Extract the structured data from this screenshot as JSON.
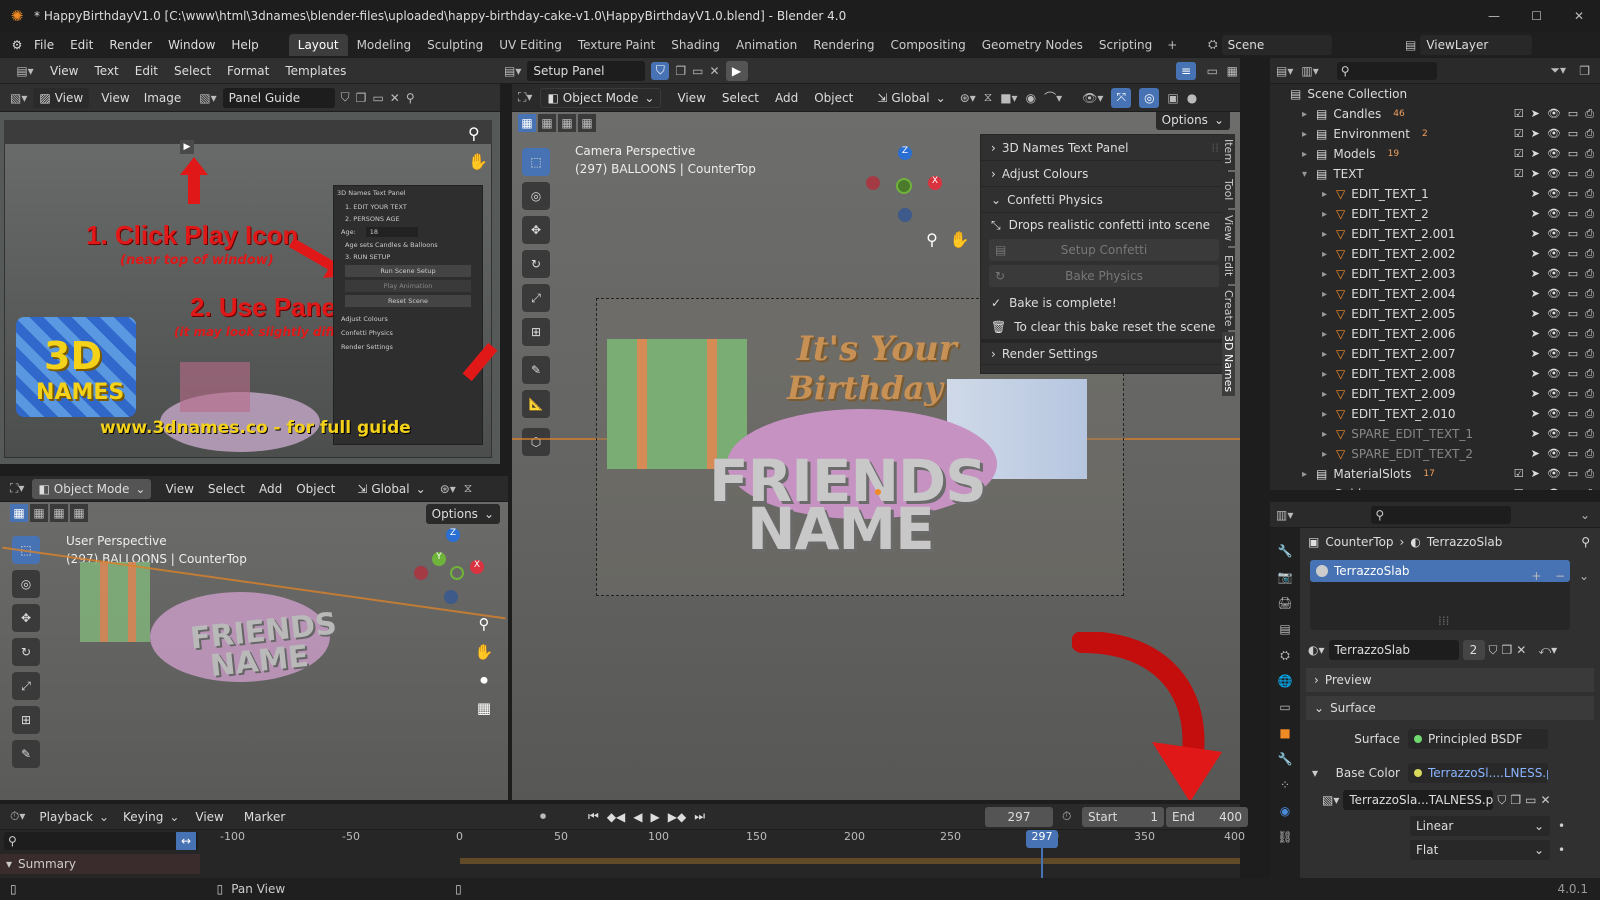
{
  "titlebar": {
    "title": "* HappyBirthdayV1.0 [C:\\www\\html\\3dnames\\blender-files\\uploaded\\happy-birthday-cake-v1.0\\HappyBirthdayV1.0.blend] - Blender 4.0"
  },
  "topmenu": {
    "items": [
      "File",
      "Edit",
      "Render",
      "Window",
      "Help"
    ]
  },
  "workspaces": [
    "Layout",
    "Modeling",
    "Sculpting",
    "UV Editing",
    "Texture Paint",
    "Shading",
    "Animation",
    "Rendering",
    "Compositing",
    "Geometry Nodes",
    "Scripting"
  ],
  "active_workspace": "Layout",
  "scene": {
    "name": "Scene",
    "viewlayer": "ViewLayer"
  },
  "text_editor": {
    "menu": [
      "View",
      "Text",
      "Edit",
      "Select",
      "Format",
      "Templates"
    ],
    "file": "Setup Panel"
  },
  "image_editor": {
    "view_label": "View",
    "menu": [
      "View",
      "Image"
    ],
    "image": "Panel Guide"
  },
  "guide_image": {
    "step1": "1. Click Play Icon",
    "step1_sub": "(near top of window)",
    "step2": "2. Use Panel",
    "step2_sub": "(it may look slightly different)",
    "logo_top": "3D",
    "logo_bottom": "NAMES",
    "url": "www.3dnames.co - for full guide",
    "mini_panel": [
      "3D Names Text Panel",
      "1. EDIT YOUR TEXT",
      "2. PERSONS AGE",
      "Age:",
      "18",
      "Age sets Candles & Balloons",
      "3. RUN SETUP",
      "Run Scene Setup",
      "Play Animation",
      "Reset Scene",
      "Adjust Colours",
      "Confetti Physics",
      "Render Settings"
    ]
  },
  "viewport_main": {
    "mode": "Object Mode",
    "menu": [
      "View",
      "Select",
      "Add",
      "Object"
    ],
    "orientation": "Global",
    "options": "Options",
    "line1": "Camera Perspective",
    "line2": "(297) BALLOONS | CounterTop",
    "scene_text_1": "It's Your",
    "scene_text_2": "Birthday",
    "scene_text_3": "FRIENDS",
    "scene_text_4": "NAME",
    "tabs": [
      "Item",
      "Tool",
      "View",
      "Edit",
      "Create",
      "3D Names"
    ]
  },
  "npanel": {
    "sections": [
      "3D Names Text Panel",
      "Adjust Colours",
      "Confetti Physics"
    ],
    "confetti_desc": "Drops realistic confetti into scene",
    "setup_btn": "Setup Confetti",
    "bake_btn": "Bake Physics",
    "bake_done": "Bake is complete!",
    "clear_note": "To clear this bake reset the scene",
    "render": "Render Settings"
  },
  "viewport_small": {
    "mode": "Object Mode",
    "menu": [
      "View",
      "Select",
      "Add",
      "Object"
    ],
    "orientation": "Global",
    "options": "Options",
    "line1": "User Perspective",
    "line2": "(297) BALLOONS | CounterTop"
  },
  "timeline": {
    "menu": [
      "Playback",
      "Keying",
      "View",
      "Marker"
    ],
    "frame": "297",
    "start_label": "Start",
    "start": "1",
    "end_label": "End",
    "end": "400",
    "ticks": [
      "-100",
      "-50",
      "0",
      "50",
      "100",
      "150",
      "200",
      "250",
      "300",
      "350",
      "400"
    ],
    "current": "297",
    "summary": "Summary"
  },
  "outliner": {
    "title": "Scene Collection",
    "items": [
      {
        "name": "Candles",
        "badge": "46"
      },
      {
        "name": "Environment",
        "badge": "2"
      },
      {
        "name": "Models",
        "badge": "19"
      },
      {
        "name": "TEXT",
        "badge": ""
      },
      {
        "name": "EDIT_TEXT_1",
        "badge": ""
      },
      {
        "name": "EDIT_TEXT_2",
        "badge": ""
      },
      {
        "name": "EDIT_TEXT_2.001",
        "badge": ""
      },
      {
        "name": "EDIT_TEXT_2.002",
        "badge": ""
      },
      {
        "name": "EDIT_TEXT_2.003",
        "badge": ""
      },
      {
        "name": "EDIT_TEXT_2.004",
        "badge": ""
      },
      {
        "name": "EDIT_TEXT_2.005",
        "badge": ""
      },
      {
        "name": "EDIT_TEXT_2.006",
        "badge": ""
      },
      {
        "name": "EDIT_TEXT_2.007",
        "badge": ""
      },
      {
        "name": "EDIT_TEXT_2.008",
        "badge": ""
      },
      {
        "name": "EDIT_TEXT_2.009",
        "badge": ""
      },
      {
        "name": "EDIT_TEXT_2.010",
        "badge": ""
      },
      {
        "name": "SPARE_EDIT_TEXT_1",
        "badge": ""
      },
      {
        "name": "SPARE_EDIT_TEXT_2",
        "badge": ""
      },
      {
        "name": "MaterialSlots",
        "badge": "17"
      },
      {
        "name": "Guides",
        "badge": ""
      }
    ]
  },
  "properties": {
    "breadcrumb_obj": "CounterTop",
    "breadcrumb_mat": "TerrazzoSlab",
    "slot": "TerrazzoSlab",
    "material": "TerrazzoSlab",
    "users": "2",
    "preview": "Preview",
    "surface_section": "Surface",
    "surface_label": "Surface",
    "surface_value": "Principled BSDF",
    "basecolor_label": "Base Color",
    "basecolor_value": "TerrazzoSl....LNESS.png",
    "image_name": "TerrazzoSla...TALNESS.png",
    "interp": "Linear",
    "proj": "Flat"
  },
  "statusbar": {
    "pan": "Pan View",
    "version": "4.0.1"
  },
  "colors": {
    "accent": "#4772b3",
    "red": "#e01818"
  }
}
